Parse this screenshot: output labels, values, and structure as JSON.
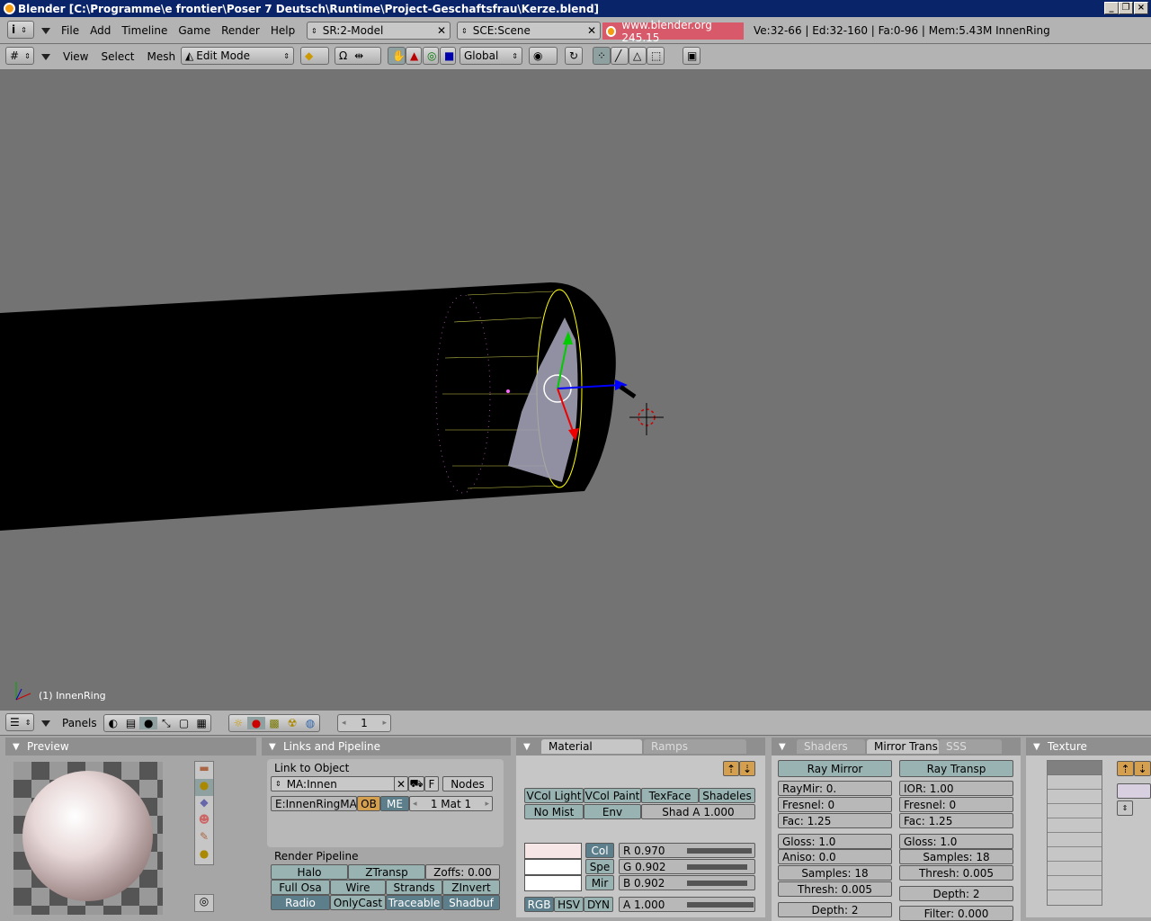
{
  "window": {
    "title": "Blender [C:\\Programme\\e frontier\\Poser 7 Deutsch\\Runtime\\Project-Geschaftsfrau\\Kerze.blend]"
  },
  "topbar": {
    "menus": [
      "File",
      "Add",
      "Timeline",
      "Game",
      "Render",
      "Help"
    ],
    "screen": "SR:2-Model",
    "scene": "SCE:Scene",
    "website": "www.blender.org 245.15",
    "stats": "Ve:32-66 | Ed:32-160 | Fa:0-96 | Mem:5.43M InnenRing"
  },
  "view3d_header": {
    "menus": [
      "View",
      "Select",
      "Mesh"
    ],
    "mode": "Edit Mode",
    "orientation": "Global"
  },
  "viewport": {
    "object_label": "(1) InnenRing"
  },
  "buttons_header": {
    "panels_label": "Panels",
    "frame": "1"
  },
  "preview": {
    "title": "Preview"
  },
  "links": {
    "title": "Links and Pipeline",
    "link_to_object": "Link to Object",
    "material": "MA:Innen",
    "f_label": "F",
    "nodes": "Nodes",
    "mesh_link": "E:InnenRingMA",
    "ob": "OB",
    "me": "ME",
    "mat_index": "1 Mat 1",
    "render_pipeline": "Render Pipeline",
    "pipeline": {
      "halo": "Halo",
      "ztransp": "ZTransp",
      "zoffs": "Zoffs: 0.00",
      "full_osa": "Full Osa",
      "wire": "Wire",
      "strands": "Strands",
      "zinvert": "ZInvert",
      "radio": "Radio",
      "onlycast": "OnlyCast",
      "traceable": "Traceable",
      "shadbuf": "Shadbuf"
    }
  },
  "material": {
    "tab_active": "Material",
    "tab_other": "Ramps",
    "vcol_light": "VCol Light",
    "vcol_paint": "VCol Paint",
    "texface": "TexFace",
    "shadeless": "Shadeles",
    "no_mist": "No Mist",
    "env": "Env",
    "shad_a": "Shad A 1.000",
    "col": "Col",
    "spe": "Spe",
    "mir": "Mir",
    "r": "R 0.970",
    "g": "G 0.902",
    "b": "B 0.902",
    "a": "A 1.000",
    "rgb": "RGB",
    "hsv": "HSV",
    "dyn": "DYN",
    "col_swatch": "#f7e6e6",
    "spe_swatch": "#ffffff",
    "mir_swatch": "#ffffff",
    "r_value": 0.97,
    "g_value": 0.902,
    "b_value": 0.902,
    "a_value": 1.0
  },
  "shaders": {
    "tabs": [
      "Shaders",
      "Mirror Trans",
      "SSS"
    ],
    "ray_mirror": "Ray Mirror",
    "ray_transp": "Ray Transp",
    "raymir": "RayMir: 0.",
    "fresnel_l": "Fresnel: 0",
    "fac_l": "Fac: 1.25",
    "ior": "IOR: 1.00",
    "fresnel_r": "Fresnel: 0",
    "fac_r": "Fac: 1.25",
    "gloss_l": "Gloss: 1.0",
    "aniso": "Aniso: 0.0",
    "samples_l": "Samples: 18",
    "thresh_l": "Thresh: 0.005",
    "depth_l": "Depth: 2",
    "gloss_r": "Gloss: 1.0",
    "samples_r": "Samples: 18",
    "thresh_r": "Thresh: 0.005",
    "depth_r": "Depth: 2",
    "filter": "Filter: 0.000"
  },
  "texture": {
    "title": "Texture"
  }
}
